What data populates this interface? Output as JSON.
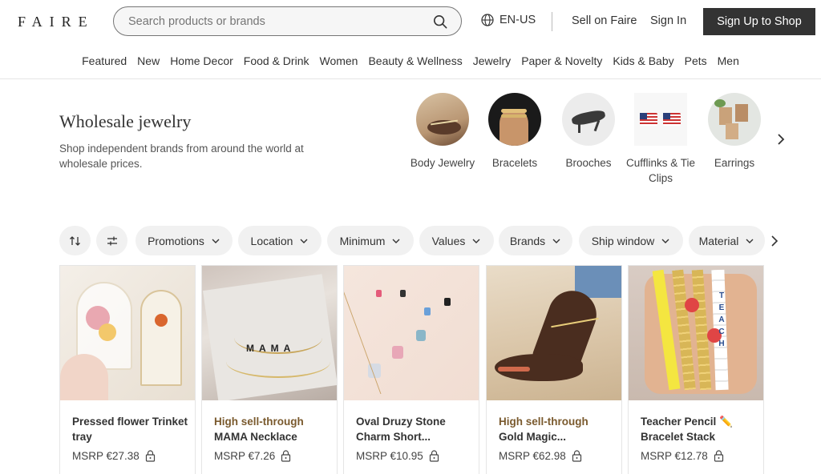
{
  "header": {
    "logo": "FAIRE",
    "search_placeholder": "Search products or brands",
    "language": "EN-US",
    "sell_link": "Sell on Faire",
    "signin_link": "Sign In",
    "signup_button": "Sign Up to Shop"
  },
  "categories": [
    "Featured",
    "New",
    "Home Decor",
    "Food & Drink",
    "Women",
    "Beauty & Wellness",
    "Jewelry",
    "Paper & Novelty",
    "Kids & Baby",
    "Pets",
    "Men"
  ],
  "hero": {
    "title": "Wholesale jewelry",
    "description": "Shop independent brands from around the world at wholesale prices."
  },
  "subcategories": [
    {
      "label": "Body Jewelry",
      "icon": "anklet-photo"
    },
    {
      "label": "Bracelets",
      "icon": "bracelet-photo"
    },
    {
      "label": "Brooches",
      "icon": "horse-brooch-photo"
    },
    {
      "label": "Cufflinks & Tie Clips",
      "icon": "flag-cufflinks-photo"
    },
    {
      "label": "Earrings",
      "icon": "earrings-photo"
    }
  ],
  "filters": [
    "Promotions",
    "Location",
    "Minimum",
    "Values",
    "Brands",
    "Ship window",
    "Material"
  ],
  "products": [
    {
      "badge": "",
      "name": "Pressed flower Trinket tray",
      "price": "MSRP €27.38"
    },
    {
      "badge": "High sell-through",
      "name": "MAMA Necklace",
      "price": "MSRP €7.26"
    },
    {
      "badge": "",
      "name": "Oval Druzy Stone Charm Short...",
      "price": "MSRP €10.95"
    },
    {
      "badge": "High sell-through",
      "name": "Gold Magic...",
      "price": "MSRP €62.98"
    },
    {
      "badge": "",
      "name": "Teacher Pencil ✏️ Bracelet Stack",
      "price": "MSRP €12.78"
    }
  ],
  "colors": {
    "signup_bg": "#333333",
    "badge": "#7a5a2e",
    "pill_bg": "#f1f1f1"
  }
}
